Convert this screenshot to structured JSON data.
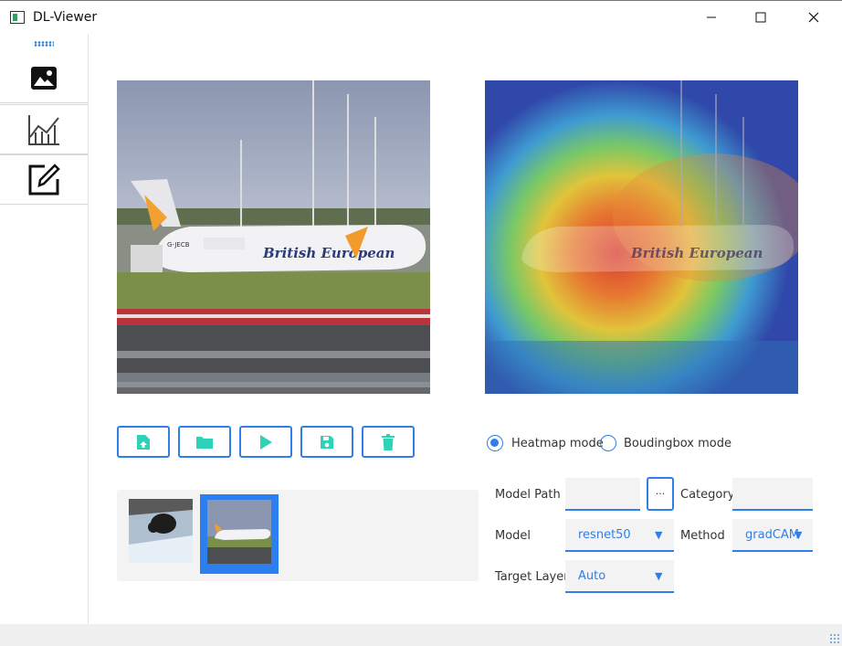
{
  "window": {
    "title": "DL-Viewer",
    "min_icon": "minimize-icon",
    "max_icon": "maximize-icon",
    "close_icon": "close-icon"
  },
  "sidebar": {
    "items": [
      {
        "name": "image",
        "icon": "image-icon",
        "active": true
      },
      {
        "name": "chart",
        "icon": "chart-icon",
        "active": false
      },
      {
        "name": "edit",
        "icon": "edit-icon",
        "active": false
      }
    ]
  },
  "toolbar": {
    "buttons": [
      {
        "name": "upload",
        "icon": "upload-file-icon"
      },
      {
        "name": "open-folder",
        "icon": "folder-icon"
      },
      {
        "name": "run",
        "icon": "play-icon"
      },
      {
        "name": "save",
        "icon": "save-icon"
      },
      {
        "name": "delete",
        "icon": "trash-icon"
      }
    ]
  },
  "images": {
    "source_text": "British European",
    "source_tail": "G-JECB"
  },
  "modes": {
    "heatmap": "Heatmap mode",
    "boundingbox": "Boudingbox mode",
    "selected": "heatmap"
  },
  "form": {
    "model_path_label": "Model Path",
    "model_path_value": "",
    "browse_label": "...",
    "category_label": "Category",
    "category_value": "",
    "model_label": "Model",
    "model_value": "resnet50",
    "method_label": "Method",
    "method_value": "gradCAM",
    "target_layer_label": "Target Layer",
    "target_layer_value": "Auto"
  },
  "thumbnails": {
    "count": 2,
    "selected": 2
  },
  "colors": {
    "accent": "#2f7fe8",
    "tool_icon": "#2ed2b8",
    "selected_thumb": "#2d7ff0"
  }
}
